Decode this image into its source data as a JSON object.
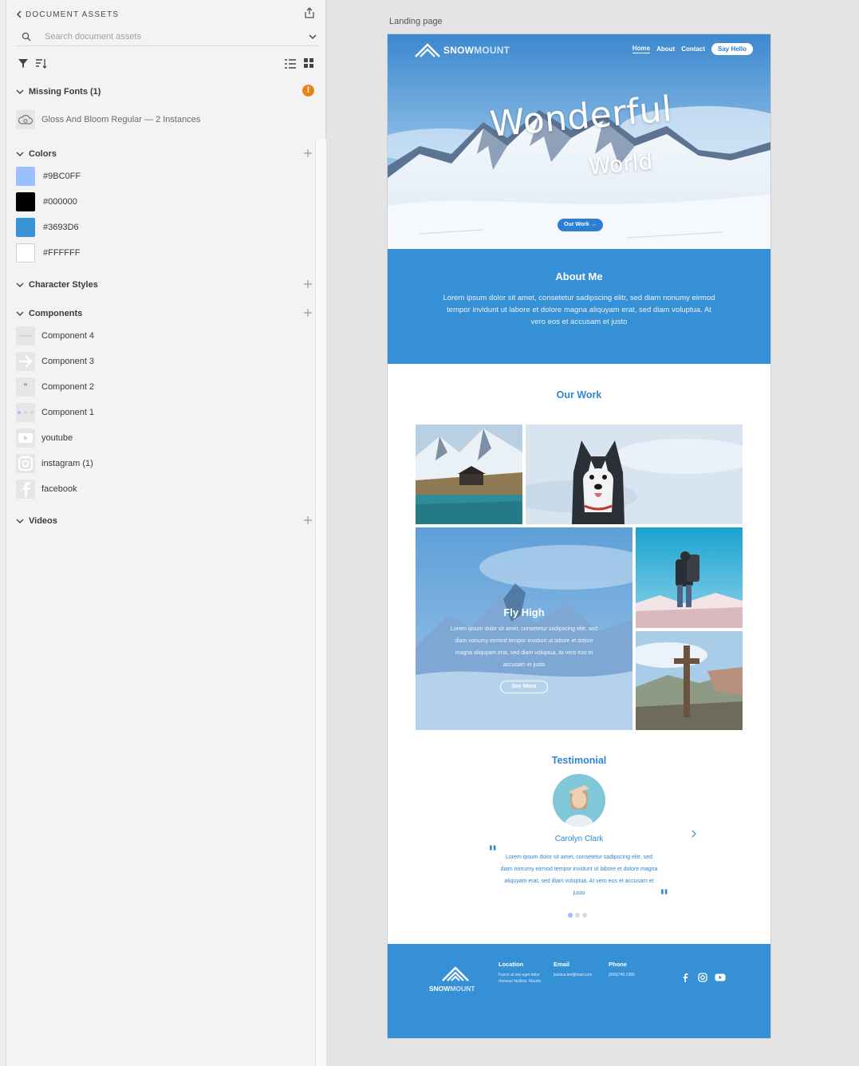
{
  "panel": {
    "title": "DOCUMENT ASSETS",
    "search_placeholder": "Search document assets",
    "missing_fonts": {
      "label": "Missing Fonts (1)",
      "items": [
        "Gloss And Bloom Regular — 2 Instances"
      ]
    },
    "colors": {
      "label": "Colors",
      "items": [
        {
          "hex": "#9BC0FF",
          "label": "#9BC0FF"
        },
        {
          "hex": "#000000",
          "label": "#000000"
        },
        {
          "hex": "#3693D6",
          "label": "#3693D6"
        },
        {
          "hex": "#FFFFFF",
          "label": "#FFFFFF"
        }
      ]
    },
    "character_styles": {
      "label": "Character Styles"
    },
    "components": {
      "label": "Components",
      "items": [
        "Component 4",
        "Component 3",
        "Component 2",
        "Component 1",
        "youtube",
        "instagram (1)",
        "facebook"
      ]
    },
    "videos": {
      "label": "Videos"
    }
  },
  "artboard": {
    "label": "Landing page",
    "nav": {
      "brand_bold": "SNOW",
      "brand_light": "MOUNT",
      "links": [
        "Home",
        "About",
        "Contact"
      ],
      "cta": "Say Hello"
    },
    "hero": {
      "title": "Wonderful",
      "subtitle": "World",
      "button": "Our Work →"
    },
    "about": {
      "heading": "About Me",
      "text": "Lorem ipsum dolor sit amet, consetetur sadipscing elitr, sed diam nonumy eirmod tempor invidunt ut labore et dolore magna aliquyam erat, sed diam voluptua. At vero eos et accusam et justo"
    },
    "our_work": {
      "heading": "Our Work",
      "feature_title": "Fly High",
      "feature_text": "Lorem ipsum dolor sit amet, consetetur sadipscing elitr, sed diam nonumy eirmod tempor invidunt ut labore et dolore magna aliquyam erat, sed diam voluptua. At vero eos et accusam et justo",
      "feature_button": "See More"
    },
    "testimonial": {
      "heading": "Testimonial",
      "name": "Carolyn Clark",
      "text": "Lorem ipsum dolor sit amet, consetetur sadipscing elitr, sed diam nonumy eirmod tempor invidunt ut labore et dolore magna aliquyam erat, sed diam voluptua. At vero eos et accusam et justo",
      "active_dot": 1,
      "dot_count": 3
    },
    "footer": {
      "brand_bold": "SNOW",
      "brand_light": "MOUNT",
      "location_h": "Location",
      "location_t": "Fusce at nisi eget dolor rhoncus facilisis. Mauris",
      "email_h": "Email",
      "email_t": "jessica.lee@mail.com",
      "phone_h": "Phone",
      "phone_t": "(859)749-1380"
    }
  }
}
